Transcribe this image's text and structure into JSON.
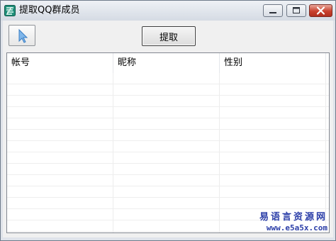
{
  "window": {
    "title": "提取QQ群成员",
    "controls": [
      "minimize-icon",
      "maximize-icon",
      "close-icon"
    ]
  },
  "toolbar": {
    "tool_icon": "cursor-arrow-icon",
    "fetch_label": "提取"
  },
  "list": {
    "columns": [
      "帐号",
      "昵称",
      "性别"
    ],
    "rows": []
  },
  "watermark": {
    "text_cn": "易语言资源网",
    "url": "www.e5a5x.com"
  },
  "colors": {
    "accent": "#2b3ea8",
    "close_button": "#c9412e"
  }
}
